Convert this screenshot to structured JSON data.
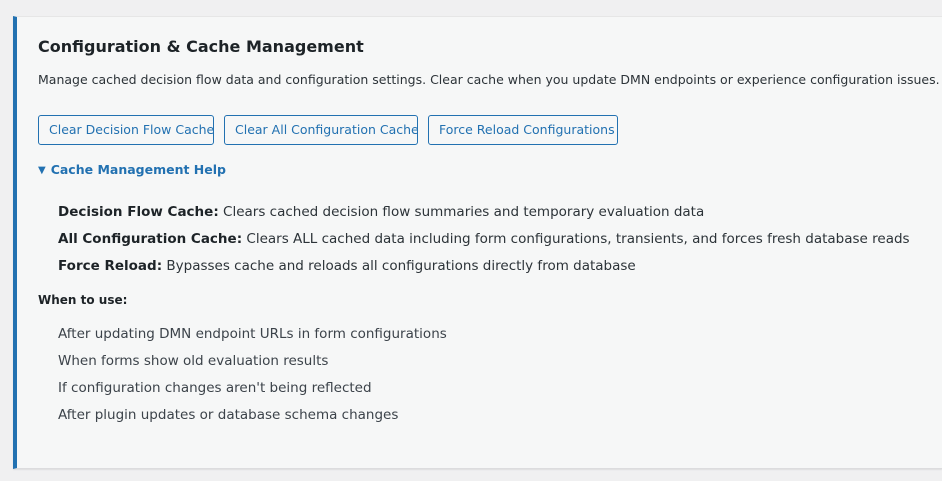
{
  "panel": {
    "title": "Configuration & Cache Management",
    "description": "Manage cached decision flow data and configuration settings. Clear cache when you update DMN endpoints or experience configuration issues.",
    "accent_color": "#2271b1"
  },
  "buttons": {
    "clear_decision_flow": "Clear Decision Flow Cache",
    "clear_all_config": "Clear All Configuration Cache",
    "force_reload": "Force Reload Configurations"
  },
  "help": {
    "toggle_label": "Cache Management Help",
    "toggle_icon": "triangle-down-icon",
    "items": [
      {
        "term": "Decision Flow Cache:",
        "text": " Clears cached decision flow summaries and temporary evaluation data"
      },
      {
        "term": "All Configuration Cache:",
        "text": " Clears ALL cached data including form configurations, transients, and forces fresh database reads"
      },
      {
        "term": "Force Reload:",
        "text": " Bypasses cache and reloads all configurations directly from database"
      }
    ],
    "when_label": "When to use:",
    "when_items": [
      "After updating DMN endpoint URLs in form configurations",
      "When forms show old evaluation results",
      "If configuration changes aren't being reflected",
      "After plugin updates or database schema changes"
    ]
  }
}
